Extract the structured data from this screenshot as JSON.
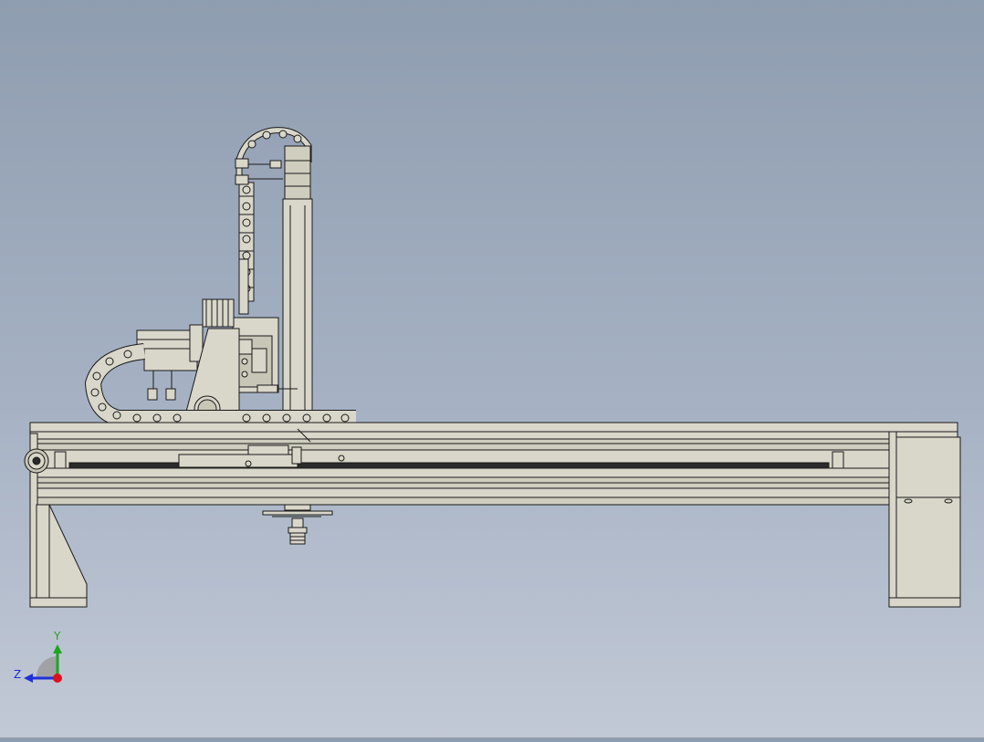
{
  "triad": {
    "y_label": "Y",
    "z_label": "Z",
    "y_color": "#1fa51f",
    "z_color": "#1f2fd8",
    "x_color": "#e0101a"
  },
  "colors": {
    "part_fill": "#d9d7c9",
    "part_fill_dark": "#c8c6b6",
    "edge": "#1a1a1a",
    "rail_dark": "#2a2a2a"
  },
  "icons": {
    "triad": "axis-triad-icon"
  }
}
